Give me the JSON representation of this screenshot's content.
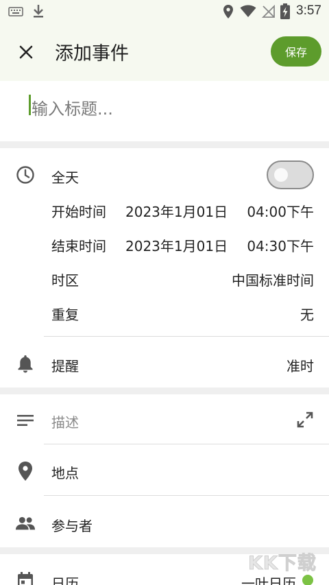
{
  "status_bar": {
    "time": "3:57",
    "icons": [
      "keyboard-icon",
      "download-icon",
      "location-icon",
      "wifi-icon",
      "no-sim-icon",
      "battery-charging-icon"
    ]
  },
  "header": {
    "title": "添加事件",
    "save_label": "保存",
    "close_icon": "close-icon",
    "accent_color": "#5d9c2c"
  },
  "title_field": {
    "placeholder": "输入标题..."
  },
  "time_section": {
    "all_day_label": "全天",
    "all_day_on": false,
    "start_label": "开始时间",
    "start_date": "2023年1月01日",
    "start_time": "04:00下午",
    "end_label": "结束时间",
    "end_date": "2023年1月01日",
    "end_time": "04:30下午",
    "timezone_label": "时区",
    "timezone_value": "中国标准时间",
    "repeat_label": "重复",
    "repeat_value": "无"
  },
  "reminder": {
    "label": "提醒",
    "value": "准时"
  },
  "details": {
    "description_placeholder": "描述",
    "location_label": "地点",
    "attendees_label": "参与者"
  },
  "calendar": {
    "label": "日历",
    "value": "一叶日历"
  },
  "watermark": "KK下载"
}
